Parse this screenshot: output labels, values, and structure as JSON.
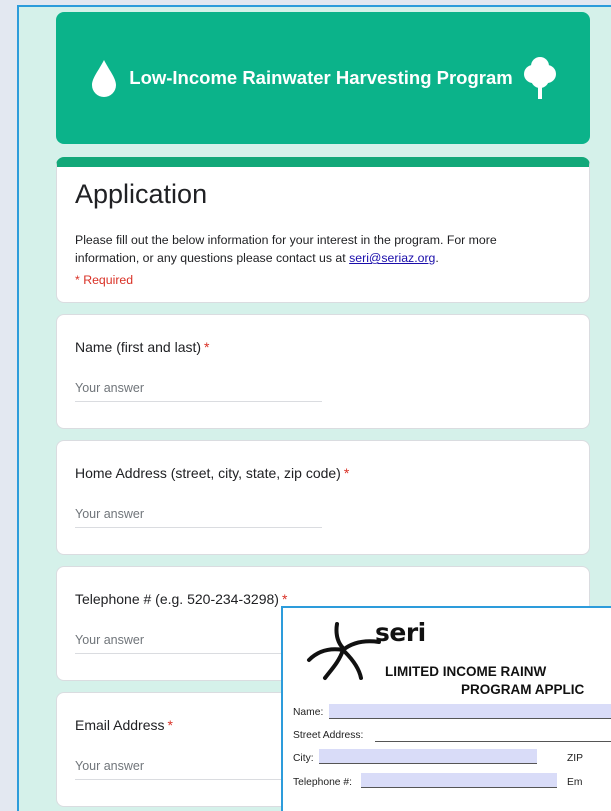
{
  "header": {
    "title": "Low-Income Rainwater Harvesting Program",
    "left_icon": "water-drop-icon",
    "right_icon": "tree-icon"
  },
  "form": {
    "title": "Application",
    "description": "Please fill out the below information for your interest in the program. For more information, or any questions please contact us at ",
    "email_link": "seri@seriaz.org",
    "description_end": ".",
    "required_note": "* Required"
  },
  "questions": [
    {
      "label": "Name (first and last)",
      "required_mark": "*",
      "placeholder": "Your answer"
    },
    {
      "label": "Home Address (street, city, state, zip code)",
      "required_mark": "*",
      "placeholder": "Your answer"
    },
    {
      "label": "Telephone # (e.g. 520-234-3298)",
      "required_mark": "*",
      "placeholder": "Your answer"
    },
    {
      "label": "Email Address",
      "required_mark": "*",
      "placeholder": "Your answer"
    }
  ],
  "paper_form": {
    "logo_text": "seri",
    "title_line1": "LIMITED INCOME RAINW",
    "title_line2": "PROGRAM APPLIC",
    "fields": {
      "name": "Name:",
      "street": "Street Address:",
      "city": "City:",
      "zip": "ZIP",
      "telephone": "Telephone #:",
      "email": "Em"
    }
  },
  "colors": {
    "header": "#0bb38a",
    "accent": "#12a879",
    "required": "#d93025",
    "background": "#d5f1ea"
  }
}
